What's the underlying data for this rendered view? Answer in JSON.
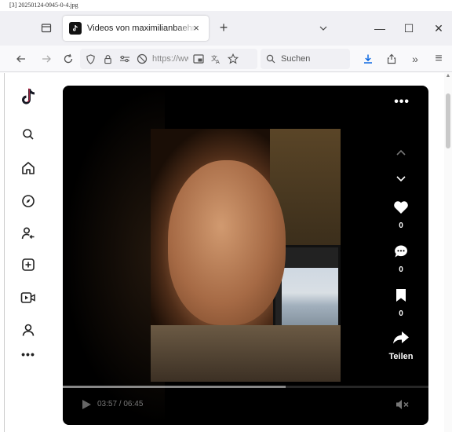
{
  "file_caption": "[3] 20250124-0945-0-4.jpg",
  "browser": {
    "tab": {
      "title": "Videos von maximilianbaehring",
      "close": "×"
    },
    "new_tab": "+",
    "window": {
      "minimize": "—",
      "maximize": "☐",
      "close": "✕"
    },
    "url_text": "https://ww",
    "search_label": "Suchen",
    "overflow": "»",
    "menu": "≡"
  },
  "video": {
    "more": "•••",
    "likes": "0",
    "comments": "0",
    "saves": "0",
    "share_label": "Teilen",
    "time": "03:57 / 06:45",
    "progress": 0.61
  },
  "colors": {
    "tiktok_black": "#000000",
    "firefox_toolbar": "#f9f9fb",
    "tab_strip": "#f0f0f4",
    "download_blue": "#0061e0"
  }
}
